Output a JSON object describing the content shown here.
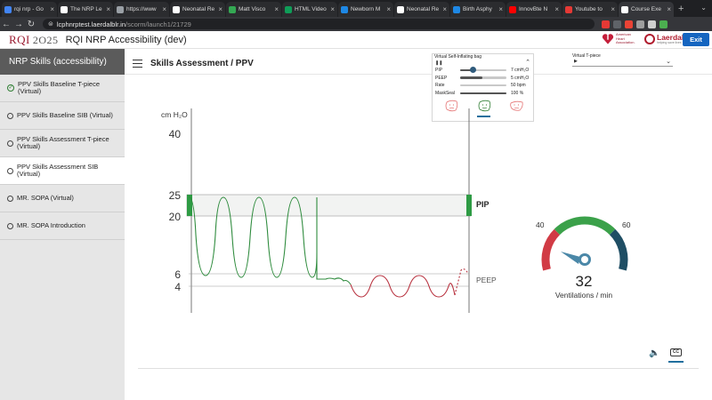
{
  "browser": {
    "tabs": [
      {
        "title": "rqi nrp - Go",
        "color": "#4285f4",
        "active": false
      },
      {
        "title": "The NRP Le",
        "color": "#ffffff",
        "active": false
      },
      {
        "title": "https://www",
        "color": "#9aa0a6",
        "active": false
      },
      {
        "title": "Neonatal Re",
        "color": "#ffffff",
        "active": false
      },
      {
        "title": "Matt Visco",
        "color": "#34a853",
        "active": false
      },
      {
        "title": "HTML Video",
        "color": "#0f9d58",
        "active": false
      },
      {
        "title": "Newborn M",
        "color": "#1e88e5",
        "active": false
      },
      {
        "title": "Neonatal Re",
        "color": "#ffffff",
        "active": false
      },
      {
        "title": "Birth Asphy",
        "color": "#1e88e5",
        "active": false
      },
      {
        "title": "InnovBte N",
        "color": "#ff0000",
        "active": false
      },
      {
        "title": "Youtube to",
        "color": "#e53935",
        "active": false
      },
      {
        "title": "Course Exe",
        "color": "#ffffff",
        "active": true
      }
    ],
    "url_host": "lcphnrptest.laerdalblr.in",
    "url_path": "/scorm/launch1/21729",
    "extension_colors": [
      "#e53935",
      "#5f6368",
      "#ea4335",
      "#9e9e9e",
      "#cfcfcf",
      "#4caf50"
    ]
  },
  "header": {
    "logo": "RQI",
    "logo_year": "2O25",
    "title": "RQI NRP Accessibility (dev)",
    "aha_text": "American Heart Association.",
    "laerdal_text": "Laerdal",
    "laerdal_sub": "helping save lives",
    "exit_label": "Exit"
  },
  "sidebar": {
    "heading": "NRP Skills (accessibility)",
    "items": [
      {
        "label": "PPV Skills Baseline T-piece (Virtual)",
        "status": "complete"
      },
      {
        "label": "PPV Skills Baseline SIB (Virtual)",
        "status": "incomplete"
      },
      {
        "label": "PPV Skills Assessment T-piece (Virtual)",
        "status": "incomplete"
      },
      {
        "label": "PPV Skills Assessment SIB (Virtual)",
        "status": "current"
      },
      {
        "label": "MR. SOPA (Virtual)",
        "status": "incomplete"
      },
      {
        "label": "MR. SOPA Introduction",
        "status": "incomplete"
      }
    ]
  },
  "main": {
    "title": "Skills Assessment / PPV"
  },
  "panel": {
    "title": "Virtual Self-Inflating bag",
    "pause_icon": "pause-icon",
    "rows": [
      {
        "label": "PIP",
        "value": "7 cmH₂O",
        "fraction": 0.28,
        "knob": true
      },
      {
        "label": "PEEP",
        "value": "5 cmH₂O",
        "fraction": 0.48,
        "knob": false
      },
      {
        "label": "Rate",
        "value": "50 bpm",
        "fraction": 0.0,
        "knob": false
      },
      {
        "label": "MaskSeal",
        "value": "100 %",
        "fraction": 1.0,
        "knob": false
      }
    ],
    "faces": [
      {
        "name": "sad-face-icon",
        "color": "#e57373"
      },
      {
        "name": "neutral-face-icon",
        "color": "#2e7d32"
      },
      {
        "name": "unhappy-face-icon",
        "color": "#e57373"
      }
    ]
  },
  "vt": {
    "label": "Virtual T-piece",
    "play_glyph": "▶"
  },
  "graph": {
    "y_unit": "cm H₂O",
    "ticks": [
      {
        "value": 40,
        "label": "40"
      },
      {
        "value": 25,
        "label": "25"
      },
      {
        "value": 20,
        "label": "20"
      },
      {
        "value": 6,
        "label": "6"
      },
      {
        "value": 4,
        "label": "4"
      }
    ],
    "pip_label": "PIP",
    "peep_label": "PEEP",
    "pip_band": [
      20,
      25
    ],
    "peep_band": [
      4,
      6
    ]
  },
  "gauge": {
    "min_label": "40",
    "max_label": "60",
    "value": "32",
    "label": "Ventilations / min",
    "colors": [
      "#d13b45",
      "#3ba14a",
      "#1f4e64"
    ]
  },
  "controls": {
    "volume_glyph": "🔈",
    "cc_label": "CC"
  }
}
